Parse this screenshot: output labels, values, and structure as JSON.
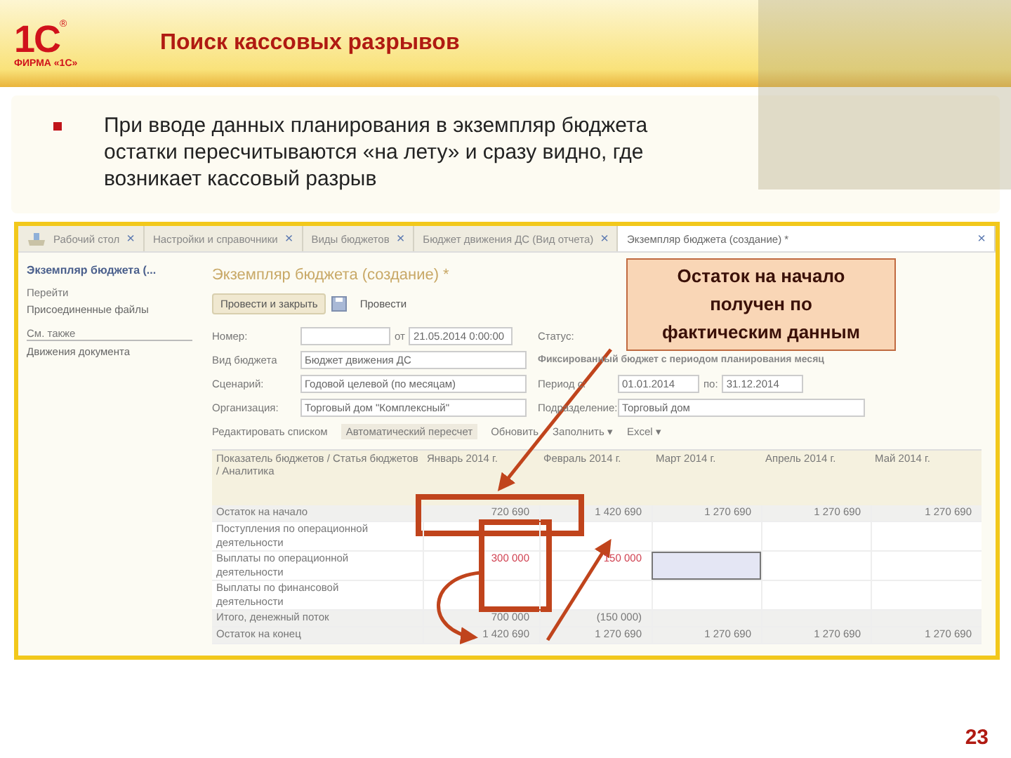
{
  "slide": {
    "logo": {
      "mark": "1С",
      "registered": "®",
      "caption": "ФИРМА «1С»"
    },
    "title": "Поиск кассовых разрывов",
    "bullet": "При вводе данных планирования в экземпляр бюджета остатки пересчитываются «на лету» и сразу видно, где возникает кассовый разрыв",
    "page_number": "23"
  },
  "app": {
    "tabs": [
      {
        "label": "Рабочий стол",
        "selected": false
      },
      {
        "label": "Настройки и справочники",
        "selected": false
      },
      {
        "label": "Виды бюджетов",
        "selected": false
      },
      {
        "label": "Бюджет движения ДС (Вид отчета)",
        "selected": false
      },
      {
        "label": "Экземпляр бюджета (создание) *",
        "selected": true
      }
    ],
    "close_glyph": "×",
    "nav": {
      "title": "Экземпляр бюджета (...",
      "go_label": "Перейти",
      "go_items": [
        "Присоединенные файлы"
      ],
      "see_also_label": "См. также",
      "see_also_items": [
        "Движения документа"
      ]
    },
    "form": {
      "title": "Экземпляр бюджета (создание) *",
      "buttons": [
        "Провести и закрыть",
        "Провести"
      ],
      "number_label": "Номер:",
      "from_label": "от",
      "date": "21.05.2014 0:00:00",
      "status_label": "Статус:",
      "budget_type_label": "Вид бюджета",
      "budget_type": "Бюджет движения ДС",
      "budget_note": "Фиксированный бюджет с периодом планирования месяц",
      "scenario_label": "Сценарий:",
      "scenario": "Годовой целевой (по месяцам)",
      "period_label": "Период с:",
      "period_from": "01.01.2014",
      "period_to_label": "по:",
      "period_to": "31.12.2014",
      "org_label": "Организация:",
      "org": "Торговый дом \"Комплексный\"",
      "dept_label": "Подразделение:",
      "dept": "Торговый дом",
      "toolbar": [
        {
          "kind": "link",
          "label": "Редактировать списком"
        },
        {
          "kind": "toggle",
          "label": "Автоматический пересчет"
        },
        {
          "kind": "link",
          "label": "Обновить"
        },
        {
          "kind": "menu",
          "label": "Заполнить ▾"
        },
        {
          "kind": "menu",
          "label": "Excel ▾"
        }
      ]
    },
    "table": {
      "columns": [
        "Показатель бюджетов / Статья бюджетов / Аналитика",
        "Январь 2014 г.",
        "Февраль 2014 г.",
        "Март 2014 г.",
        "Апрель 2014 г.",
        "Май 2014 г."
      ],
      "rows": [
        {
          "kind": "balance",
          "label": "Остаток на начало",
          "cells": [
            {
              "text": "720 690",
              "selected": false
            },
            {
              "text": "1 420 690",
              "selected": false
            },
            {
              "text": "1 270 690",
              "selected": false
            },
            {
              "text": "1 270 690",
              "selected": false
            },
            {
              "text": "1 270 690",
              "selected": false
            }
          ]
        },
        {
          "kind": "inflow",
          "label": "Поступления по операционной деятельности",
          "cells": [
            {
              "selected": false
            },
            {
              "selected": false
            },
            {
              "selected": false
            },
            {
              "selected": false
            },
            {
              "selected": false
            }
          ]
        },
        {
          "kind": "outflow",
          "label": "Выплаты по операционной деятельности",
          "cells": [
            {
              "text": "300 000",
              "selected": false
            },
            {
              "text": "150 000",
              "selected": false
            },
            {
              "selected": true
            },
            {
              "selected": false
            },
            {
              "selected": false
            }
          ]
        },
        {
          "kind": "outflow",
          "label": "Выплаты по финансовой деятельности",
          "cells": [
            {
              "selected": false
            },
            {
              "selected": false
            },
            {
              "selected": false
            },
            {
              "selected": false
            },
            {
              "selected": false
            }
          ]
        },
        {
          "kind": "total",
          "label": "Итого, денежный поток",
          "cells": [
            {
              "text": "700 000",
              "selected": false
            },
            {
              "text": "(150 000)",
              "selected": false
            },
            {
              "selected": false
            },
            {
              "selected": false
            },
            {
              "selected": false
            }
          ]
        },
        {
          "kind": "balance",
          "label": "Остаток на конец",
          "cells": [
            {
              "text": "1 420 690",
              "selected": false
            },
            {
              "text": "1 270 690",
              "selected": false
            },
            {
              "text": "1 270 690",
              "selected": false
            },
            {
              "text": "1 270 690",
              "selected": false
            },
            {
              "text": "1 270 690",
              "selected": false
            }
          ]
        }
      ]
    }
  },
  "callout": "Остаток на начало получен по фактическим данным"
}
